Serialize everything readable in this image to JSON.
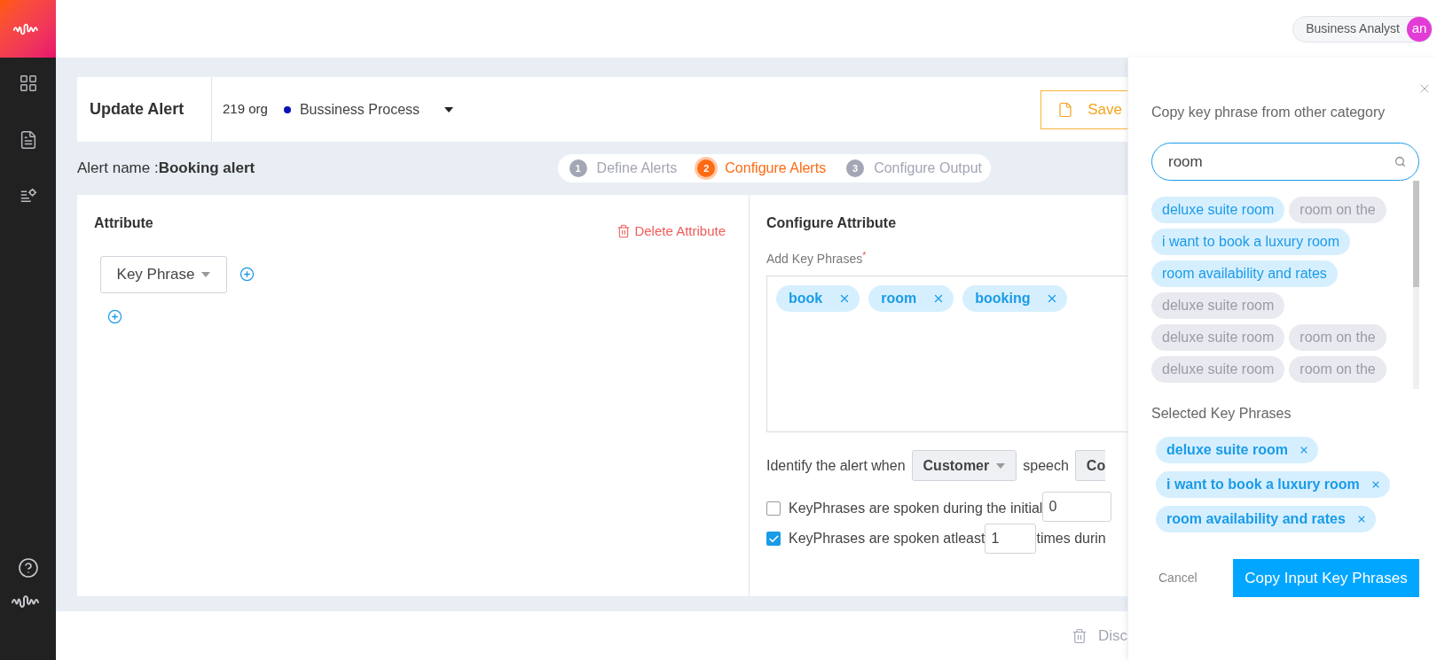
{
  "topbar": {
    "role": "Business Analyst",
    "avatar": "an"
  },
  "header": {
    "title": "Update Alert",
    "org": "219 org",
    "process": "Bussiness Process",
    "save": "Save"
  },
  "alert_name": {
    "label": "Alert name :",
    "value": "Booking alert"
  },
  "steps": [
    {
      "number": "1",
      "label": "Define Alerts",
      "selected": false
    },
    {
      "number": "2",
      "label": "Configure Alerts",
      "selected": true
    },
    {
      "number": "3",
      "label": "Configure Output",
      "selected": false
    }
  ],
  "attribute": {
    "title": "Attribute",
    "delete": "Delete Attribute",
    "type": "Key Phrase"
  },
  "configure": {
    "title": "Configure Attribute",
    "label": "Add Key Phrases",
    "required_mark": "*",
    "phrases": [
      "book",
      "room",
      "booking"
    ],
    "identify": {
      "before": "Identify the alert when",
      "speaker": "Customer",
      "middle": "speech",
      "condition": "Co"
    },
    "options": [
      {
        "checked": false,
        "text": "KeyPhrases are spoken during the initial",
        "value": "0"
      },
      {
        "checked": true,
        "text": "KeyPhrases are spoken atleast",
        "value": "1",
        "after": "times durin"
      }
    ]
  },
  "footer": {
    "discard": "Disc"
  },
  "panel": {
    "title": "Copy key phrase from other category",
    "search": "room",
    "suggestions": [
      {
        "label": "deluxe suite room",
        "selected": true
      },
      {
        "label": "room on the",
        "selected": false
      },
      {
        "label": "i want to book a luxury room",
        "selected": true
      },
      {
        "label": "room availability and rates",
        "selected": true
      },
      {
        "label": "deluxe suite room",
        "selected": false
      },
      {
        "label": "deluxe suite room",
        "selected": false
      },
      {
        "label": "room on the",
        "selected": false
      },
      {
        "label": "deluxe suite room",
        "selected": false
      },
      {
        "label": "room on the",
        "selected": false
      }
    ],
    "selected_title": "Selected Key Phrases",
    "selected": [
      "deluxe suite room",
      "i want to book a luxury room",
      "room availability and rates"
    ],
    "cancel": "Cancel",
    "copy": "Copy Input Key Phrases"
  }
}
